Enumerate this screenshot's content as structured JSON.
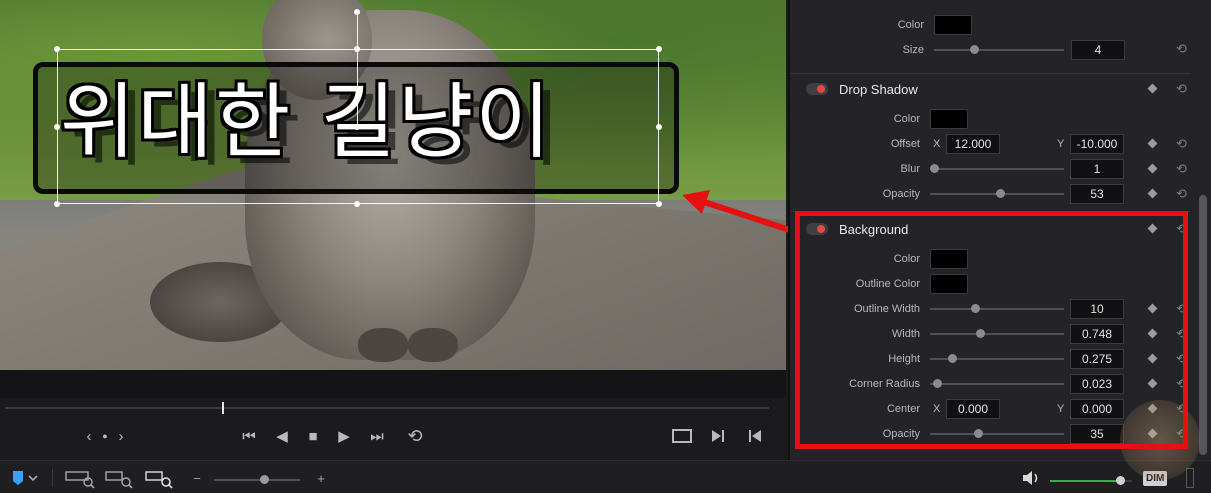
{
  "viewer": {
    "title_text": "위대한 길냥이"
  },
  "transport": {
    "nav_prev": "‹",
    "nav_dot": "●",
    "nav_next": "›",
    "skip_start": "⏮",
    "step_back": "◀",
    "stop": "■",
    "play": "▶",
    "skip_end": "⏭",
    "loop": "⟲"
  },
  "bottom_bar": {
    "dim_label": "DIM",
    "zoom_minus": "−",
    "zoom_plus": "+",
    "volume_level": 0.85
  },
  "inspector": {
    "top": {
      "color_label": "Color",
      "size_label": "Size",
      "size_value": "4",
      "size_level": 0.3
    },
    "drop_shadow": {
      "title": "Drop Shadow",
      "color_label": "Color",
      "offset_label": "Offset",
      "offset_x_label": "X",
      "offset_x": "12.000",
      "offset_y_label": "Y",
      "offset_y": "-10.000",
      "blur_label": "Blur",
      "blur_value": "1",
      "blur_level": 0.0,
      "opacity_label": "Opacity",
      "opacity_value": "53",
      "opacity_level": 0.53
    },
    "background": {
      "title": "Background",
      "color_label": "Color",
      "outline_color_label": "Outline Color",
      "outline_width_label": "Outline Width",
      "outline_width_value": "10",
      "outline_width_level": 0.33,
      "width_label": "Width",
      "width_value": "0.748",
      "width_level": 0.37,
      "height_label": "Height",
      "height_value": "0.275",
      "height_level": 0.14,
      "corner_radius_label": "Corner Radius",
      "corner_radius_value": "0.023",
      "corner_radius_level": 0.02,
      "center_label": "Center",
      "center_x_label": "X",
      "center_x": "0.000",
      "center_y_label": "Y",
      "center_y": "0.000",
      "opacity_label": "Opacity",
      "opacity_value": "35",
      "opacity_level": 0.35
    }
  },
  "colors": {
    "accent_red": "#e51010",
    "toggle_on": "#e24a3b",
    "panel_bg": "#242428",
    "volume_green": "#34b24a"
  },
  "icons": {
    "keyframe": "diamond-icon",
    "reset": "reset-icon",
    "volume": "speaker-icon",
    "flag": "flag-icon"
  }
}
